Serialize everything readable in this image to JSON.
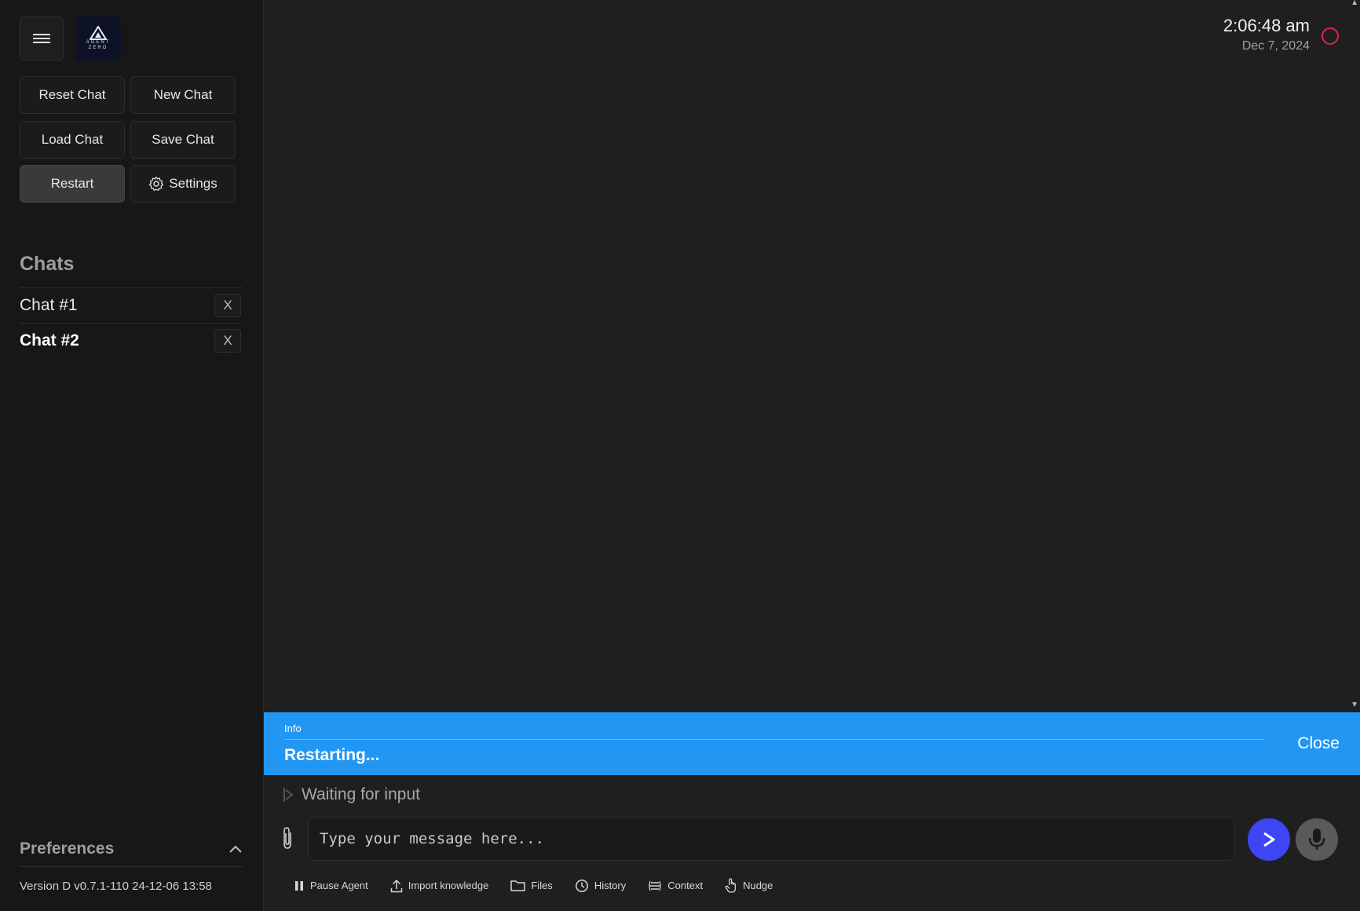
{
  "sidebar": {
    "menu_icon": "hamburger-menu-icon",
    "logo_text": "AGENT ZERO",
    "buttons": {
      "reset_chat": "Reset Chat",
      "new_chat": "New Chat",
      "load_chat": "Load Chat",
      "save_chat": "Save Chat",
      "restart": "Restart",
      "settings": "Settings"
    },
    "chats_title": "Chats",
    "chats": [
      {
        "label": "Chat #1",
        "close": "X"
      },
      {
        "label": "Chat #2",
        "close": "X",
        "current": true
      }
    ],
    "preferences_label": "Preferences",
    "version": "Version D v0.7.1-110 24-12-06 13:58"
  },
  "header": {
    "time": "2:06:48 am",
    "date": "Dec 7, 2024",
    "status_color": "#e0204a"
  },
  "toast": {
    "type": "Info",
    "message": "Restarting...",
    "close": "Close",
    "color": "#2196f3"
  },
  "progress_text": "Waiting for input",
  "input": {
    "placeholder": "Type your message here...",
    "value": ""
  },
  "send_color": "#3d45f5",
  "actions": [
    {
      "label": "Pause Agent",
      "icon": "pause-icon"
    },
    {
      "label": "Import knowledge",
      "icon": "upload-icon"
    },
    {
      "label": "Files",
      "icon": "folder-icon"
    },
    {
      "label": "History",
      "icon": "history-icon"
    },
    {
      "label": "Context",
      "icon": "context-icon"
    },
    {
      "label": "Nudge",
      "icon": "hand-pointer-icon"
    }
  ]
}
